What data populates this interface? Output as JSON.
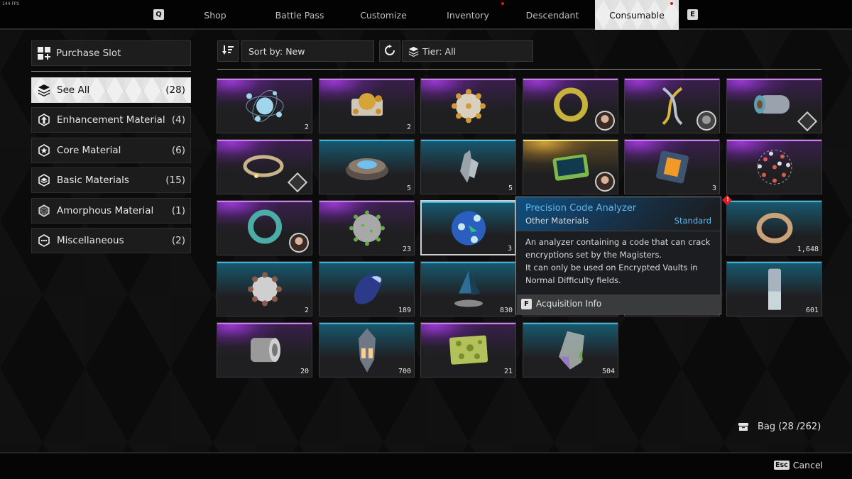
{
  "fps": "144 FPS",
  "nav": {
    "left_key": "Q",
    "right_key": "E",
    "tabs": [
      {
        "label": "Shop",
        "active": false,
        "notify": false
      },
      {
        "label": "Battle Pass",
        "active": false,
        "notify": false
      },
      {
        "label": "Customize",
        "active": false,
        "notify": false
      },
      {
        "label": "Inventory",
        "active": false,
        "notify": true
      },
      {
        "label": "Descendant",
        "active": false,
        "notify": false
      },
      {
        "label": "Consumable",
        "active": true,
        "notify": true
      }
    ]
  },
  "sidebar": {
    "purchase_slot": {
      "label": "Purchase Slot",
      "icon": "grid-plus-icon"
    },
    "categories": [
      {
        "label": "See All",
        "count": "(28)",
        "icon": "layers-icon",
        "active": true
      },
      {
        "label": "Enhancement Material",
        "count": "(4)",
        "icon": "arrow-up-hex-icon",
        "active": false
      },
      {
        "label": "Core Material",
        "count": "(6)",
        "icon": "star-hex-icon",
        "active": false
      },
      {
        "label": "Basic Materials",
        "count": "(15)",
        "icon": "layer-hex-icon",
        "active": false
      },
      {
        "label": "Amorphous Material",
        "count": "(1)",
        "icon": "web-hex-icon",
        "active": false
      },
      {
        "label": "Miscellaneous",
        "count": "(2)",
        "icon": "dots-hex-icon",
        "active": false
      }
    ]
  },
  "toolbar": {
    "sort_icon": "sort-descending-icon",
    "sort_label": "Sort by: New",
    "refresh_icon": "refresh-icon",
    "tier_icon": "layers-icon",
    "tier_label": "Tier: All"
  },
  "items": [
    {
      "rarity": "purple",
      "qty": "2",
      "art": "atom-orb",
      "badge": null
    },
    {
      "rarity": "purple",
      "qty": "2",
      "art": "gold-device",
      "badge": null
    },
    {
      "rarity": "purple",
      "qty": "",
      "art": "spiked-sphere-gold",
      "badge": null
    },
    {
      "rarity": "purple",
      "qty": "",
      "art": "gold-ring",
      "badge": "portrait"
    },
    {
      "rarity": "purple",
      "qty": "",
      "art": "dna-helix",
      "badge": "portrait-mech"
    },
    {
      "rarity": "purple",
      "qty": "",
      "art": "fabric-roll",
      "badge": "diamond"
    },
    {
      "rarity": "purple",
      "qty": "",
      "art": "cable-coil",
      "badge": "diamond"
    },
    {
      "rarity": "blue",
      "qty": "5",
      "art": "disc-device",
      "badge": null
    },
    {
      "rarity": "blue",
      "qty": "5",
      "art": "crystal-shard",
      "badge": null
    },
    {
      "rarity": "gold",
      "qty": "",
      "art": "tablet-scanner",
      "badge": "portrait"
    },
    {
      "rarity": "purple",
      "qty": "3",
      "art": "orange-cube",
      "badge": null
    },
    {
      "rarity": "purple",
      "qty": "",
      "art": "molecule-ball",
      "badge": null
    },
    {
      "rarity": "purple",
      "qty": "",
      "art": "teal-ring",
      "badge": "portrait"
    },
    {
      "rarity": "purple",
      "qty": "23",
      "art": "virus-sphere",
      "badge": null
    },
    {
      "rarity": "blue",
      "qty": "3",
      "art": "blue-analyzer-sphere",
      "badge": null,
      "selected": true
    },
    {
      "rarity": "blue",
      "qty": "",
      "art": "hidden",
      "badge": null
    },
    {
      "rarity": "blue",
      "qty": "",
      "art": "hidden",
      "badge": null
    },
    {
      "rarity": "blue",
      "qty": "1,648",
      "art": "liquid-swirl",
      "badge": null,
      "alert": true
    },
    {
      "rarity": "blue",
      "qty": "2",
      "art": "spiked-sphere-silver",
      "badge": null
    },
    {
      "rarity": "blue",
      "qty": "189",
      "art": "liquid-blob",
      "badge": null
    },
    {
      "rarity": "blue",
      "qty": "830",
      "art": "prism-pyramid",
      "badge": null
    },
    {
      "rarity": "blue",
      "qty": "",
      "art": "hidden",
      "badge": null
    },
    {
      "rarity": "blue",
      "qty": "",
      "art": "hidden",
      "badge": null
    },
    {
      "rarity": "blue",
      "qty": "601",
      "art": "metal-cylinder",
      "badge": null
    },
    {
      "rarity": "purple",
      "qty": "20",
      "art": "metal-spool",
      "badge": null
    },
    {
      "rarity": "blue",
      "qty": "700",
      "art": "thruster-capsule",
      "badge": null
    },
    {
      "rarity": "purple",
      "qty": "21",
      "art": "green-sponge",
      "badge": null
    },
    {
      "rarity": "blue",
      "qty": "504",
      "art": "glass-shard",
      "badge": null
    }
  ],
  "tooltip": {
    "title": "Precision Code Analyzer",
    "subtype": "Other Materials",
    "grade": "Standard",
    "desc_line1": "An analyzer containing a code that can crack",
    "desc_line2": "encryptions set by the Magisters.",
    "desc_line3": "It can only be used on Encrypted Vaults in",
    "desc_line4": "Normal Difficulty fields.",
    "footer_key": "F",
    "footer_label": "Acquisition Info"
  },
  "alert_glyph": "!",
  "bag": {
    "label": "Bag (28 /262)",
    "icon": "bag-icon"
  },
  "cancel": {
    "key": "Esc",
    "label": "Cancel"
  },
  "colors": {
    "purple_rarity": "#d17af5",
    "blue_rarity": "#3cb3e0",
    "gold_rarity": "#f5e07a",
    "tooltip_title": "#5fb8f0",
    "notify_dot": "#e0141a"
  }
}
